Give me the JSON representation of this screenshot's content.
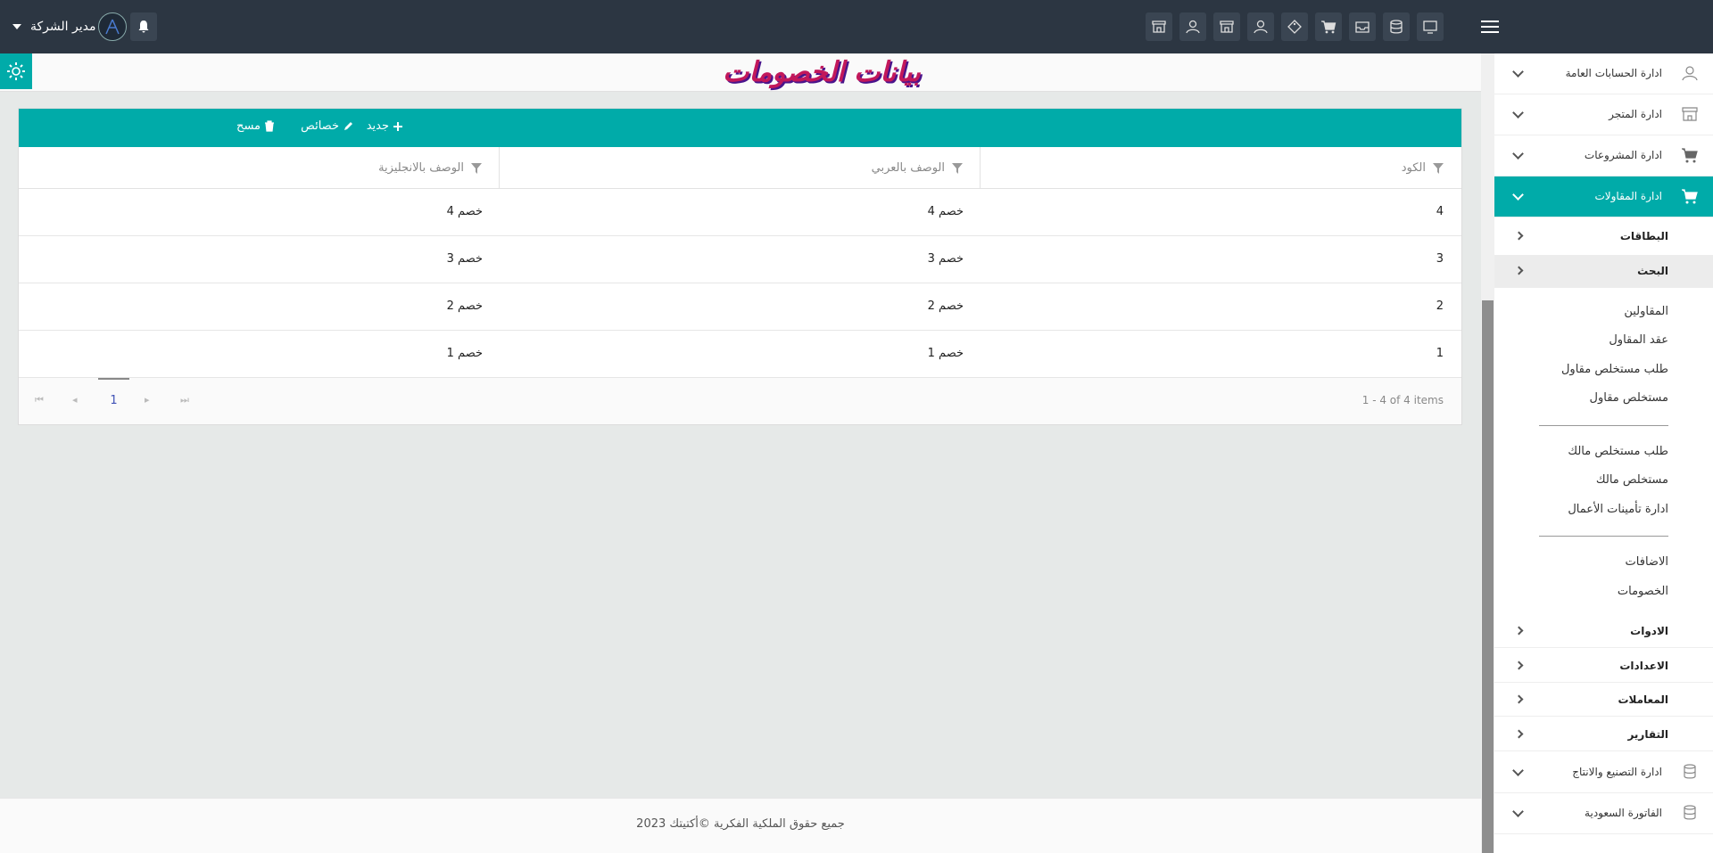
{
  "topbar": {
    "user_name": "مدير الشركة",
    "icons": [
      "monitor-icon",
      "database-icon",
      "inbox-icon",
      "cart-icon",
      "tag-icon",
      "user-icon",
      "store-icon",
      "user-icon",
      "store-icon"
    ]
  },
  "page": {
    "title": "بيانات الخصومات"
  },
  "toolbar": {
    "new_label": "جديد",
    "props_label": "خصائص",
    "delete_label": "مسح"
  },
  "grid": {
    "columns": [
      "الكود",
      "الوصف بالعربي",
      "الوصف بالانجليزية"
    ],
    "rows": [
      {
        "code": "4",
        "ar": "خصم 4",
        "en": "خصم 4"
      },
      {
        "code": "3",
        "ar": "خصم 3",
        "en": "خصم 3"
      },
      {
        "code": "2",
        "ar": "خصم 2",
        "en": "خصم 2"
      },
      {
        "code": "1",
        "ar": "خصم 1",
        "en": "خصم 1"
      }
    ],
    "pager": {
      "current_page": "1",
      "info": "1 - 4 of 4 items"
    }
  },
  "sidebar": {
    "items": [
      {
        "label": "ادارة الحسابات العامة",
        "icon": "user-icon"
      },
      {
        "label": "ادارة المتجر",
        "icon": "store-icon"
      },
      {
        "label": "ادارة المشروعات",
        "icon": "cart-icon"
      },
      {
        "label": "ادارة المقاولات",
        "icon": "cart-icon",
        "active": true
      }
    ],
    "subs": [
      {
        "label": "البطاقات"
      },
      {
        "label": "البحث"
      }
    ],
    "links_group1": [
      "المقاولين",
      "عقد المقاول",
      "طلب مستخلص مقاول",
      "مستخلص مقاول"
    ],
    "links_group2": [
      "طلب مستخلص مالك",
      "مستخلص مالك",
      "ادارة تأمينات الأعمال"
    ],
    "links_group3": [
      "الاضافات",
      "الخصومات"
    ],
    "subs2": [
      {
        "label": "الادوات"
      },
      {
        "label": "الاعدادات"
      },
      {
        "label": "المعاملات"
      },
      {
        "label": "التقارير"
      }
    ],
    "items2": [
      {
        "label": "ادارة التصنيع والانتاج",
        "icon": "database-icon"
      },
      {
        "label": "الفاتورة السعودية",
        "icon": "database-icon"
      }
    ]
  },
  "footer": {
    "copyright": "جميع حقوق الملكية الفكرية ©أكتيتك 2023"
  },
  "colors": {
    "accent": "#00aba9",
    "topbar": "#2c3642",
    "title": "#c2185b"
  }
}
